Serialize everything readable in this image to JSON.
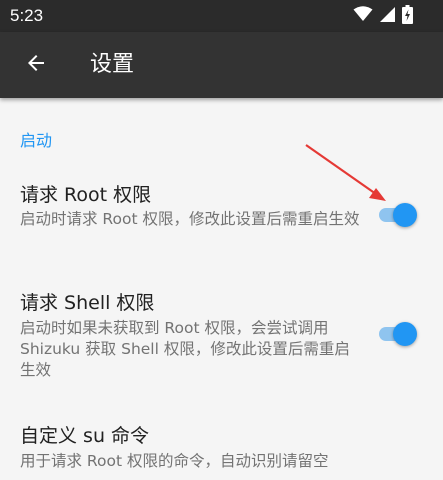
{
  "status_bar": {
    "time": "5:23",
    "icons": [
      "wifi-icon",
      "signal-icon",
      "battery-icon"
    ]
  },
  "app_bar": {
    "back_icon": "back-arrow-icon",
    "title": "设置"
  },
  "sections": [
    {
      "header": "启动",
      "header_color": "#2196f3",
      "preferences": [
        {
          "title": "请求 Root 权限",
          "summary": "启动时请求 Root 权限，修改此设置后需重启生效",
          "switch_on": true
        },
        {
          "title": "请求 Shell 权限",
          "summary": "启动时如果未获取到 Root 权限，会尝试调用 Shizuku 获取 Shell 权限，修改此设置后需重启生效",
          "switch_on": true
        },
        {
          "title": "自定义 su 命令",
          "summary": "用于请求 Root 权限的命令，自动识别请留空"
        }
      ]
    }
  ],
  "colors": {
    "accent": "#2196f3",
    "annotation_arrow": "#e53935",
    "app_bar": "#333333",
    "status_bar": "#2b2b2b",
    "background": "#f5f5f5"
  }
}
